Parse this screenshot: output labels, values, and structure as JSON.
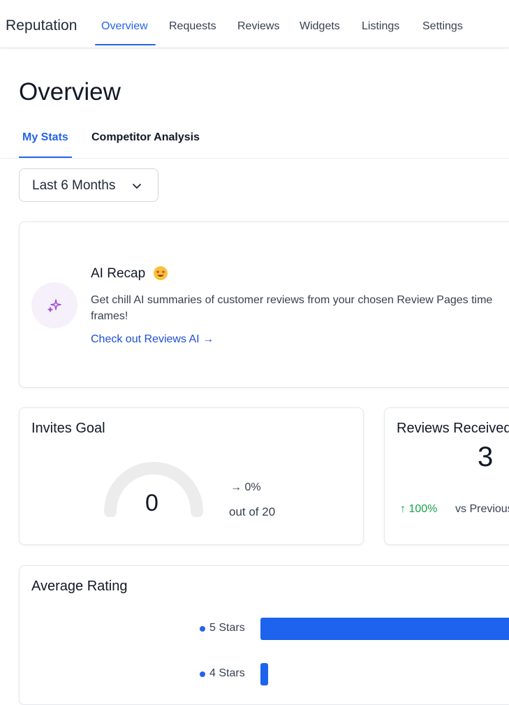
{
  "app": {
    "brand": "Reputation"
  },
  "nav": {
    "items": [
      {
        "label": "Overview",
        "active": true
      },
      {
        "label": "Requests",
        "active": false
      },
      {
        "label": "Reviews",
        "active": false
      },
      {
        "label": "Widgets",
        "active": false
      },
      {
        "label": "Listings",
        "active": false
      },
      {
        "label": "Settings",
        "active": false
      }
    ]
  },
  "page": {
    "title": "Overview"
  },
  "subtabs": [
    {
      "label": "My Stats",
      "active": true
    },
    {
      "label": "Competitor Analysis",
      "active": false
    }
  ],
  "date_range": {
    "selected": "Last 6 Months",
    "icon": "chevron-down-icon"
  },
  "ai_recap": {
    "title": "AI Recap",
    "emoji_icon": "star-struck-emoji-icon",
    "icon": "sparkles-icon",
    "description": "Get chill AI summaries of customer reviews from your chosen Review Pages time frames!",
    "link": "Check out Reviews AI →"
  },
  "invites_goal": {
    "title": "Invites Goal",
    "value": "0",
    "change": "→ 0%",
    "out_of": "out of 20",
    "progress_fraction": 0
  },
  "reviews_received": {
    "title": "Reviews Received",
    "count": "3",
    "trend": "↑ 100%",
    "comparison": "vs Previous"
  },
  "average_rating": {
    "title": "Average Rating",
    "rows": [
      {
        "label": "5 Stars",
        "fraction": 1.0
      },
      {
        "label": "4 Stars",
        "fraction": 0.03
      }
    ]
  },
  "colors": {
    "accent": "#2563eb",
    "bar": "#1d63ed",
    "positive": "#16a34a",
    "gauge_track": "#ececec",
    "sparkle": "#a24fd6"
  }
}
